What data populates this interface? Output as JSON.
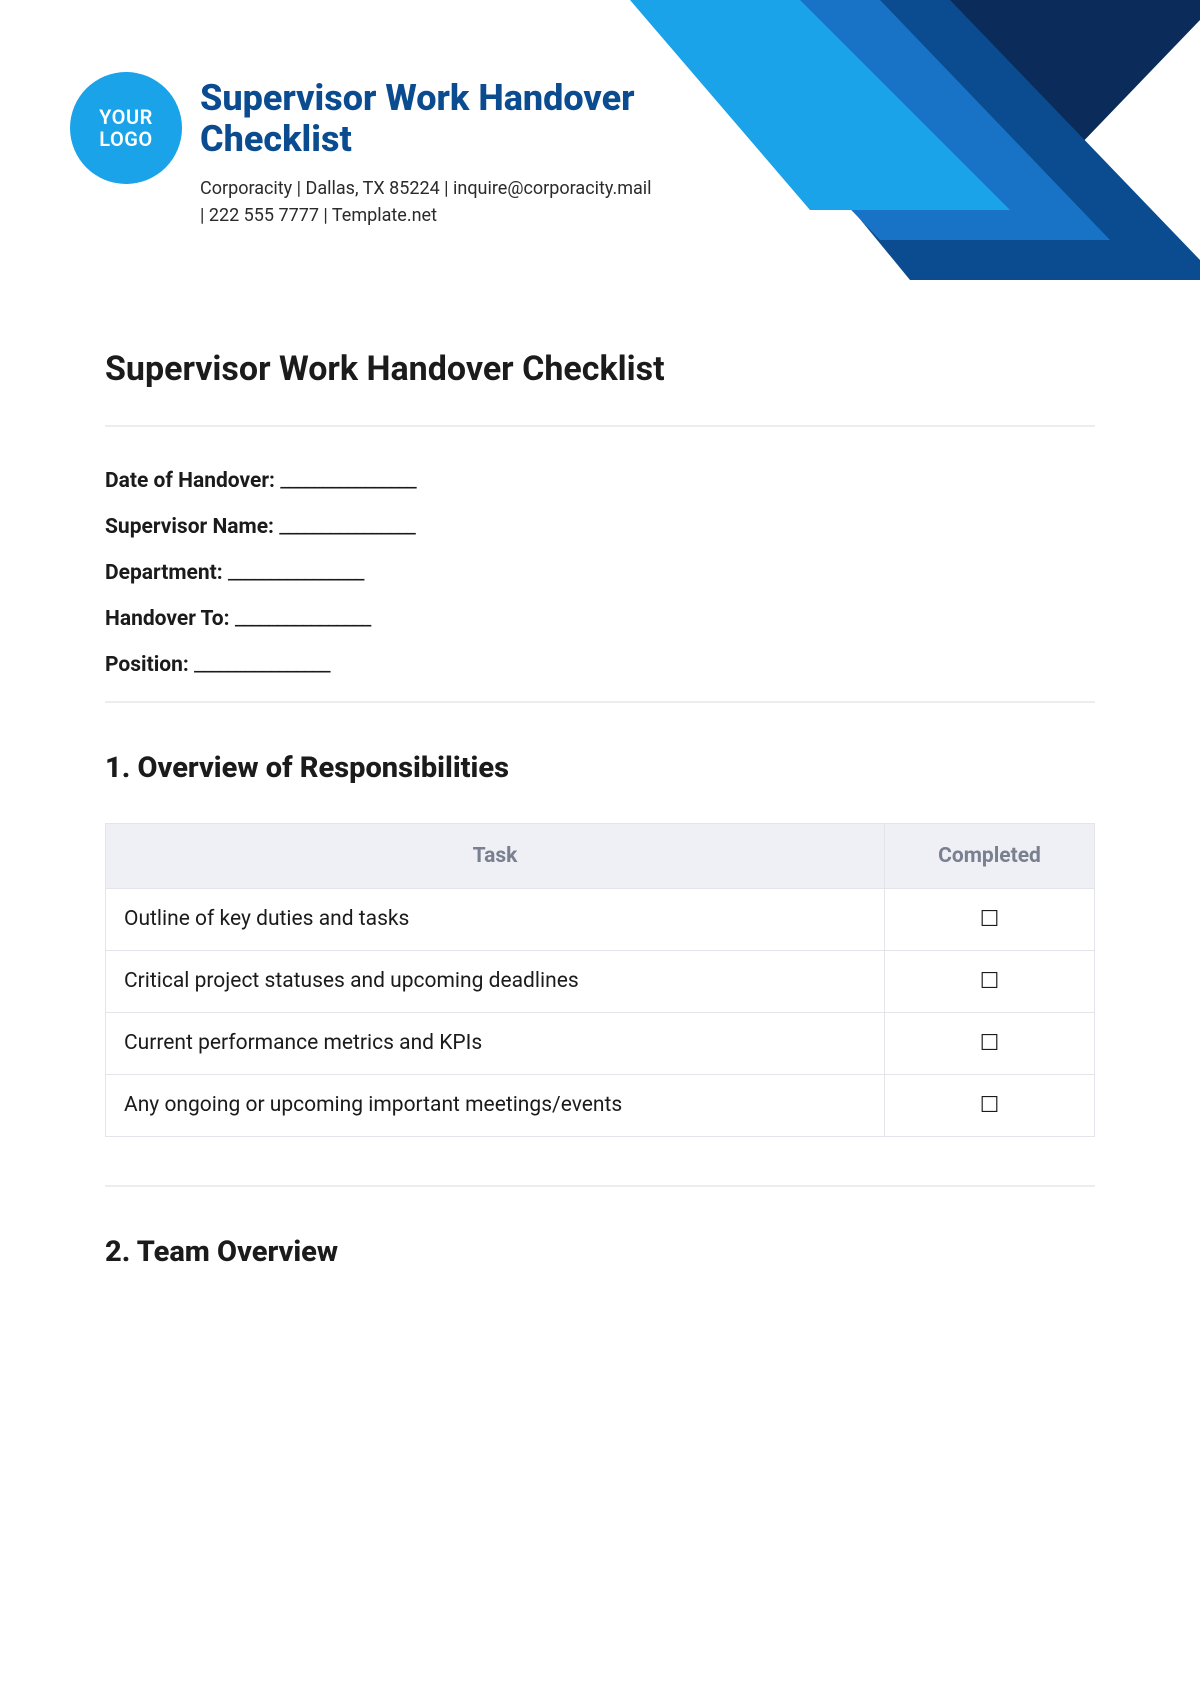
{
  "logo": {
    "line1": "YOUR",
    "line2": "LOGO"
  },
  "header": {
    "title": "Supervisor Work Handover Checklist",
    "meta_line1": "Corporacity | Dallas, TX 85224 | inquire@corporacity.mail",
    "meta_line2": "| 222 555 7777 | Template.net"
  },
  "main": {
    "title": "Supervisor Work Handover Checklist",
    "fields": [
      {
        "label": "Date of Handover:",
        "blank": "________________"
      },
      {
        "label": "Supervisor Name:",
        "blank": "________________"
      },
      {
        "label": "Department:",
        "blank": "________________"
      },
      {
        "label": "Handover To:",
        "blank": "________________"
      },
      {
        "label": "Position:",
        "blank": "________________"
      }
    ],
    "sections": [
      {
        "title": "1. Overview of Responsibilities",
        "columns": {
          "task": "Task",
          "completed": "Completed"
        },
        "rows": [
          {
            "task": "Outline of key duties and tasks",
            "check": "☐"
          },
          {
            "task": "Critical project statuses and upcoming deadlines",
            "check": "☐"
          },
          {
            "task": "Current performance metrics and KPIs",
            "check": "☐"
          },
          {
            "task": "Any ongoing or upcoming important meetings/events",
            "check": "☐"
          }
        ]
      },
      {
        "title": "2. Team Overview"
      }
    ]
  }
}
